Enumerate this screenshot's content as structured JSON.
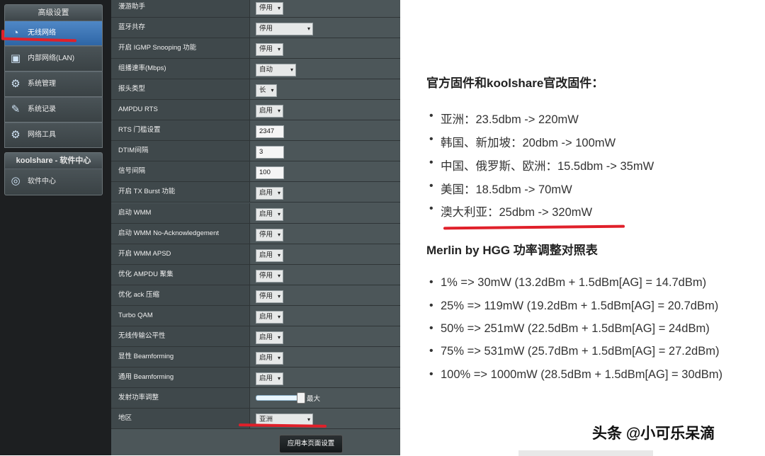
{
  "sidebar": {
    "section1_title": "高级设置",
    "items": [
      {
        "label": "无线网络",
        "icon": "wifi-icon"
      },
      {
        "label": "内部网络(LAN)",
        "icon": "monitor-icon"
      },
      {
        "label": "系统管理",
        "icon": "gear-icon"
      },
      {
        "label": "系统记录",
        "icon": "log-icon"
      },
      {
        "label": "网络工具",
        "icon": "tools-icon"
      }
    ],
    "section2_title": "koolshare - 软件中心",
    "software_center": {
      "label": "软件中心",
      "icon": "swirl-icon"
    }
  },
  "settings": {
    "rows": [
      {
        "label": "漫游助手",
        "type": "select",
        "value": "停用"
      },
      {
        "label": "蓝牙共存",
        "type": "select",
        "value": "停用"
      },
      {
        "label": "开启 IGMP Snooping 功能",
        "type": "select",
        "value": "停用"
      },
      {
        "label": "组播速率(Mbps)",
        "type": "select",
        "value": "自动"
      },
      {
        "label": "报头类型",
        "type": "select",
        "value": "长"
      },
      {
        "label": "AMPDU RTS",
        "type": "select",
        "value": "启用"
      },
      {
        "label": "RTS 门槛设置",
        "type": "text",
        "value": "2347"
      },
      {
        "label": "DTIM间隔",
        "type": "text",
        "value": "3"
      },
      {
        "label": "信号间隔",
        "type": "text",
        "value": "100"
      },
      {
        "label": "开启 TX Burst 功能",
        "type": "select",
        "value": "启用"
      },
      {
        "label": "启动 WMM",
        "type": "select",
        "value": "启用"
      },
      {
        "label": "启动 WMM No-Acknowledgement",
        "type": "select",
        "value": "停用"
      },
      {
        "label": "开启 WMM APSD",
        "type": "select",
        "value": "启用"
      },
      {
        "label": "优化 AMPDU 聚集",
        "type": "select",
        "value": "停用"
      },
      {
        "label": "优化 ack 压缩",
        "type": "select",
        "value": "停用"
      },
      {
        "label": "Turbo QAM",
        "type": "select",
        "value": "启用"
      },
      {
        "label": "无线传输公平性",
        "type": "select",
        "value": "启用"
      },
      {
        "label": "显性 Beamforming",
        "type": "select",
        "value": "启用"
      },
      {
        "label": "通用 Beamforming",
        "type": "select",
        "value": "启用"
      },
      {
        "label": "发射功率调整",
        "type": "slider",
        "value": "最大",
        "level": 1.0
      },
      {
        "label": "地区",
        "type": "select",
        "value": "亚洲"
      }
    ],
    "apply_label": "应用本页面设置"
  },
  "article": {
    "heading1": "官方固件和koolshare官改固件：",
    "list1": [
      "亚洲：23.5dbm -> 220mW",
      "韩国、新加坡：20dbm -> 100mW",
      "中国、俄罗斯、欧洲：15.5dbm -> 35mW",
      "美国：18.5dbm -> 70mW",
      "澳大利亚：25dbm -> 320mW"
    ],
    "heading2": "Merlin by HGG 功率调整对照表",
    "list2": [
      "1% => 30mW (13.2dBm + 1.5dBm[AG] = 14.7dBm)",
      "25% => 119mW (19.2dBm + 1.5dBm[AG] = 20.7dBm)",
      "50% => 251mW (22.5dBm + 1.5dBm[AG] = 24dBm)",
      "75% => 531mW (25.7dBm + 1.5dBm[AG] = 27.2dBm)",
      "100% => 1000mW (28.5dBm + 1.5dBm[AG] = 30dBm)"
    ]
  },
  "watermark": "头条 @小可乐呆滴",
  "colors": {
    "annotation_red": "#e0202a",
    "active_menu": "#3c78b8"
  }
}
